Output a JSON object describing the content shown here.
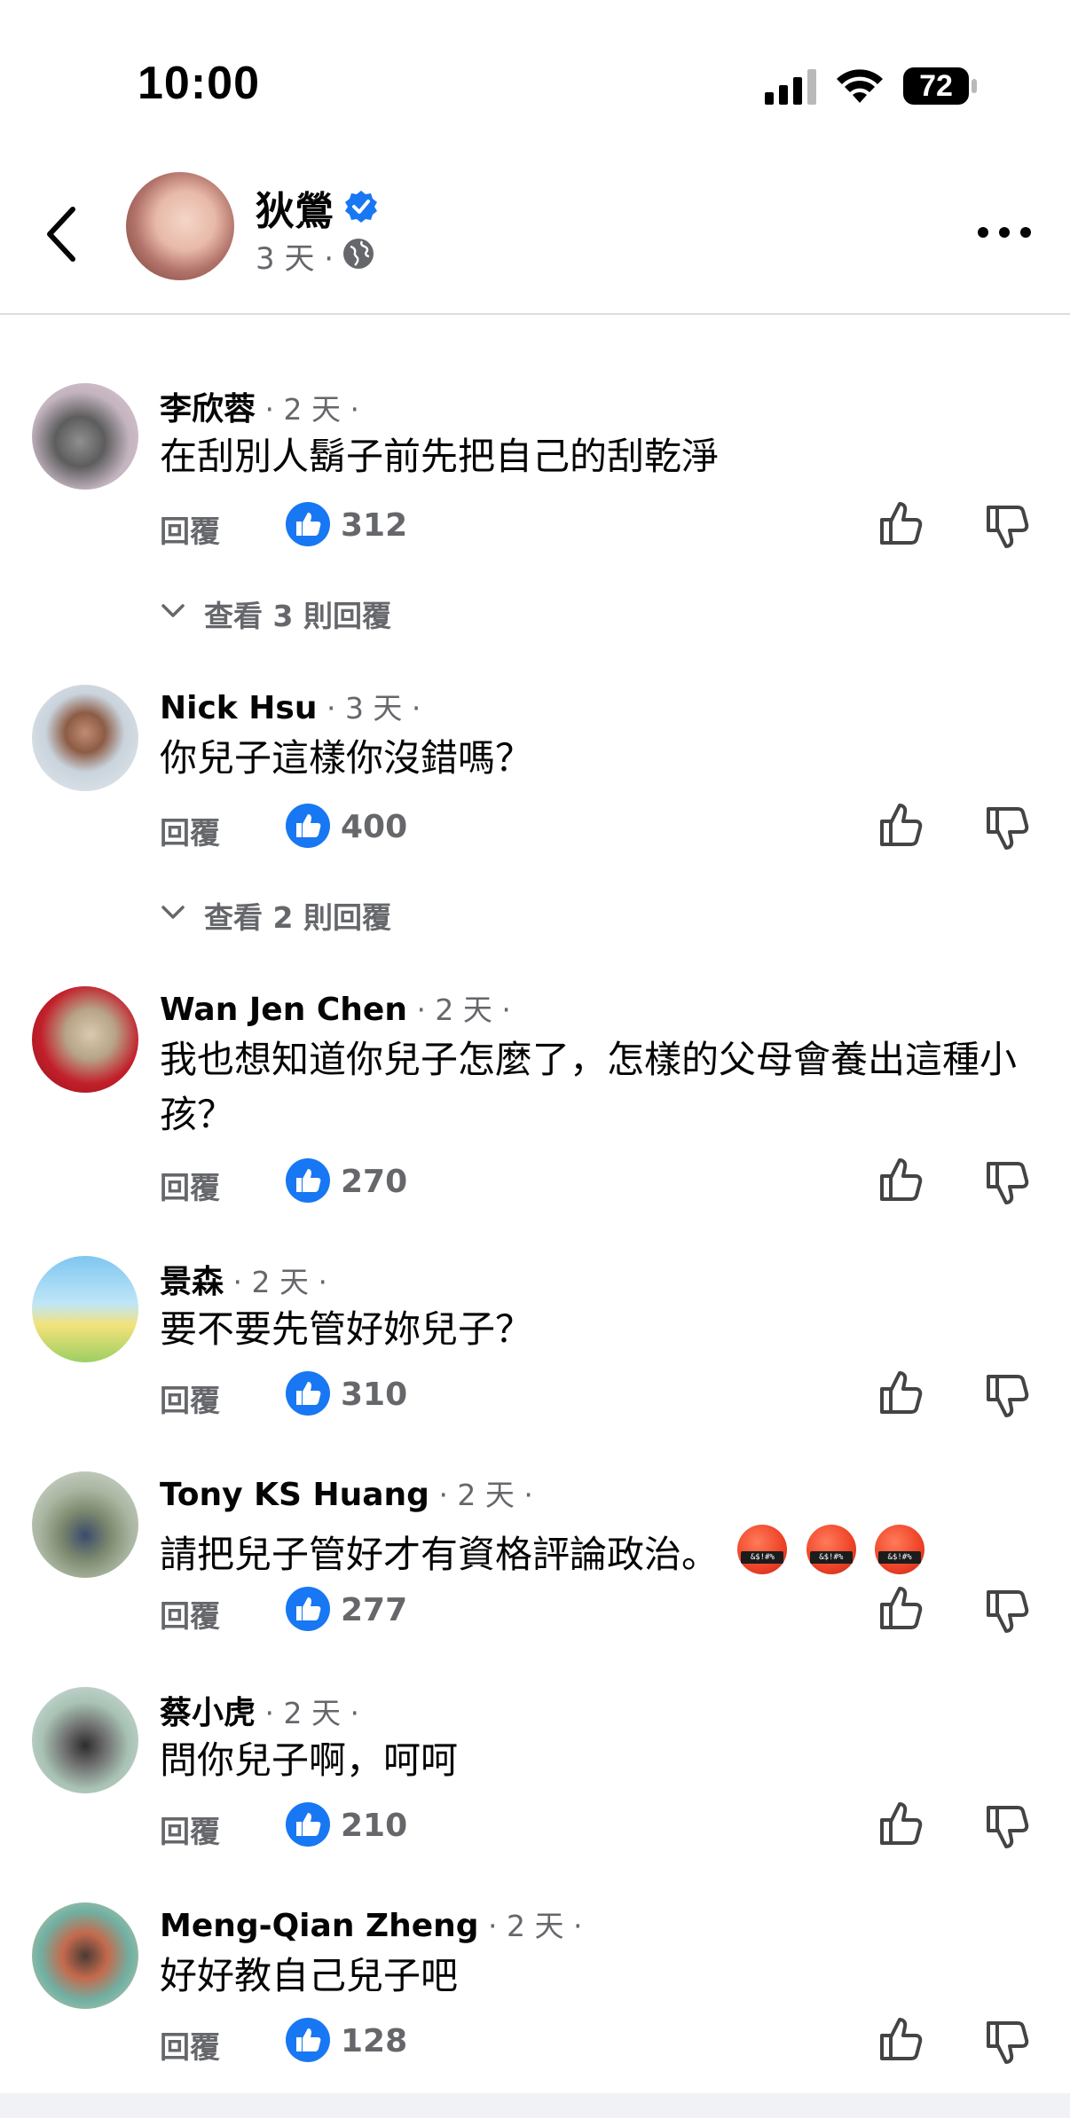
{
  "status_bar": {
    "time": "10:00",
    "battery": "72"
  },
  "post": {
    "author": "狄鶯",
    "meta": "3 天 ·"
  },
  "comments": [
    {
      "name": "李欣蓉",
      "time": " · 2 天 ·",
      "text": "在刮別人鬍子前先把自己的刮乾淨",
      "reply_label": "回覆",
      "likes": "312",
      "view_replies": "查看 3 則回覆"
    },
    {
      "name": "Nick Hsu",
      "time": " · 3 天 ·",
      "text": "你兒子這樣你沒錯嗎？",
      "reply_label": "回覆",
      "likes": "400",
      "view_replies": "查看 2 則回覆"
    },
    {
      "name": "Wan Jen Chen",
      "time": " · 2 天 ·",
      "text": "我也想知道你兒子怎麼了，怎樣的父母會養出這種小孩？",
      "reply_label": "回覆",
      "likes": "270"
    },
    {
      "name": "景森",
      "time": " · 2 天 ·",
      "text": "要不要先管好妳兒子？",
      "reply_label": "回覆",
      "likes": "310"
    },
    {
      "name": "Tony KS Huang",
      "time": " · 2 天 ·",
      "text": "請把兒子管好才有資格評論政治。",
      "reply_label": "回覆",
      "likes": "277"
    },
    {
      "name": "蔡小虎",
      "time": " · 2 天 ·",
      "text": "問你兒子啊，呵呵",
      "reply_label": "回覆",
      "likes": "210"
    },
    {
      "name": "Meng-Qian Zheng",
      "time": " · 2 天 ·",
      "text": "好好教自己兒子吧",
      "reply_label": "回覆",
      "likes": "128"
    }
  ],
  "colors": {
    "facebook_blue": "#1877f2",
    "secondary_text": "#65676b"
  },
  "icons": [
    "back-arrow-icon",
    "verified-badge-icon",
    "globe-icon",
    "more-icon",
    "like-badge-icon",
    "thumb-up-icon",
    "thumb-down-icon",
    "chevron-down-icon",
    "pouting-face-with-symbols-emoji"
  ]
}
